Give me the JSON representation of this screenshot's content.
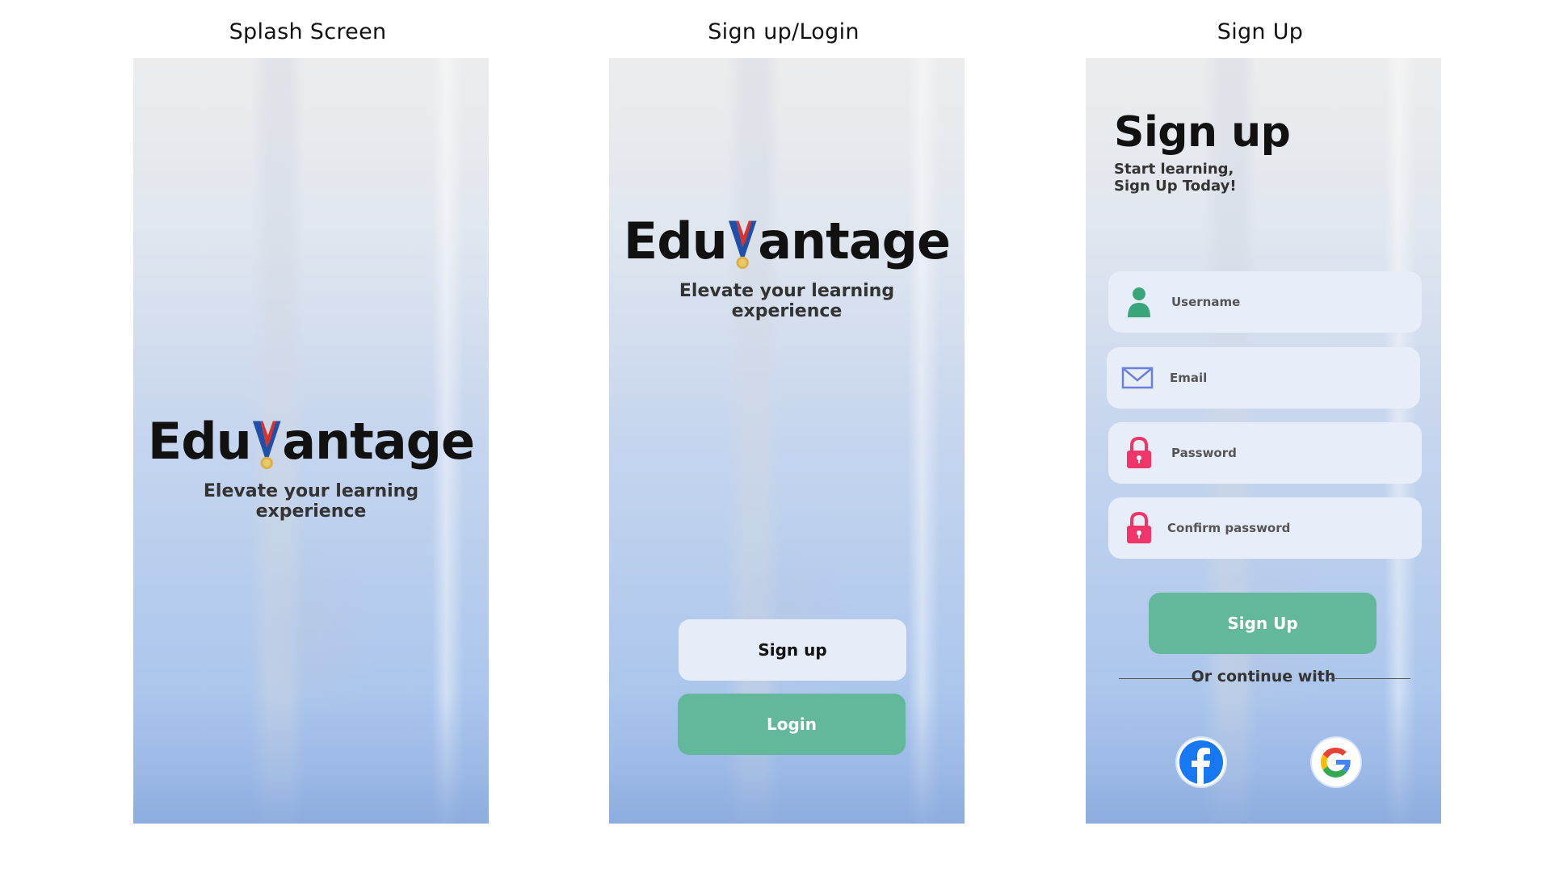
{
  "screens": {
    "splash": {
      "title": "Splash Screen",
      "logo_pre": "Edu",
      "logo_post": "antage",
      "tagline_line1": "Elevate your learning",
      "tagline_line2": "experience"
    },
    "welcome": {
      "title": "Sign up/Login",
      "logo_pre": "Edu",
      "logo_post": "antage",
      "tagline_line1": "Elevate your learning",
      "tagline_line2": "experience",
      "signup_label": "Sign up",
      "login_label": "Login"
    },
    "signup": {
      "title": "Sign Up",
      "heading": "Sign up",
      "sub_line1": "Start learning,",
      "sub_line2": "Sign Up Today!",
      "fields": [
        {
          "placeholder": "Username",
          "icon": "user-icon"
        },
        {
          "placeholder": "Email",
          "icon": "mail-icon"
        },
        {
          "placeholder": "Password",
          "icon": "lock-icon"
        },
        {
          "placeholder": "Confirm password",
          "icon": "lock-icon"
        }
      ],
      "submit_label": "Sign Up",
      "divider_text": "Or continue with",
      "social": [
        "facebook-icon",
        "google-icon"
      ]
    }
  },
  "colors": {
    "accent_green": "#63b89c",
    "field_bg": "#e8eef9",
    "lock_pink": "#f0356b",
    "user_green": "#3aa57a",
    "mail_blue": "#6b7fe3",
    "facebook_blue": "#1877f2"
  }
}
